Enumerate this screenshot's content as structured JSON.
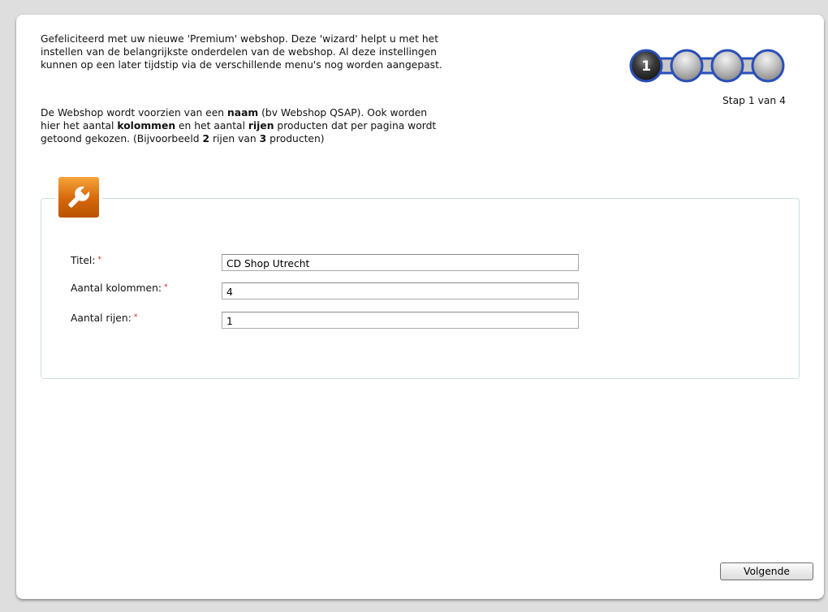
{
  "intro": {
    "line1": "Gefeliciteerd met uw nieuwe 'Premium' webshop. Deze 'wizard' helpt u met het",
    "line2": "instellen van de belangrijkste onderdelen van de webshop. Al deze instellingen",
    "line3": "kunnen op een later tijdstip via de verschillende menu's nog worden aangepast."
  },
  "description": {
    "l1_a": "De Webshop wordt voorzien van een ",
    "l1_b": "naam",
    "l1_c": " (bv Webshop QSAP). Ook worden",
    "l2_a": "hier het aantal ",
    "l2_b": "kolommen",
    "l2_c": " en het aantal ",
    "l2_d": "rijen",
    "l2_e": " producten dat per pagina wordt",
    "l3_a": "getoond gekozen. (Bijvoorbeeld ",
    "l3_b": "2",
    "l3_c": " rijen van ",
    "l3_d": "3",
    "l3_e": " producten)"
  },
  "steps": {
    "current_number": "1",
    "current": 1,
    "total": 4,
    "label": "Stap 1 van 4"
  },
  "form": {
    "title": {
      "label": "Titel:",
      "required_mark": "*",
      "value": "CD Shop Utrecht"
    },
    "columns": {
      "label": "Aantal kolommen:",
      "required_mark": "*",
      "value": "4"
    },
    "rows": {
      "label": "Aantal rijen:",
      "required_mark": "*",
      "value": "1"
    }
  },
  "buttons": {
    "next_label": "Volgende"
  },
  "icons": {
    "settings": "wrench-icon"
  },
  "colors": {
    "badge_orange": "#e07512",
    "required_red": "#d21a1a",
    "panel_border": "#cfdde0"
  }
}
